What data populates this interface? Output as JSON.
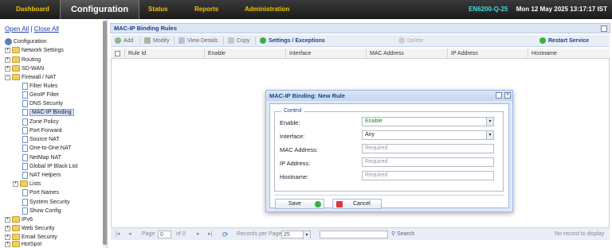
{
  "nav": {
    "items": [
      "Dashboard",
      "Configuration",
      "Status",
      "Reports",
      "Administration"
    ],
    "device": "EN6200-Q-25",
    "datetime": "Mon 12 May 2025 13:17:17 IST"
  },
  "sidebar": {
    "open_all": "Open All",
    "sep": "|",
    "close_all": "Close All",
    "root": "Configuration",
    "items": [
      "Network Settings",
      "Routing",
      "SD-WAN",
      "Firewall / NAT",
      "Filter Rules",
      "GeoIP Filter",
      "DNS Security",
      "MAC-IP Binding",
      "Zone Policy",
      "Port Forward",
      "Source NAT",
      "One-to-One NAT",
      "NetMap NAT",
      "Global IP Black List",
      "NAT Helpers",
      "Lists",
      "Port Names",
      "System Security",
      "Show Config",
      "IPv6",
      "Web Security",
      "Email Security",
      "HotSpot"
    ]
  },
  "panel": {
    "title": "MAC-IP Binding Rules",
    "toolbar": {
      "add": "Add",
      "modify": "Modify",
      "view_details": "View Details",
      "copy": "Copy",
      "settings": "Settings / Exceptions",
      "delete": "Delete",
      "restart": "Restart Service"
    },
    "columns": [
      "Rule Id",
      "Enable",
      "Interface",
      "MAC Address",
      "IP Address",
      "Hostname"
    ],
    "pager": {
      "page": "Page",
      "page_value": "0",
      "of": "of 0",
      "records_per_page": "Records per Page",
      "records_value": "25",
      "search": "Search",
      "empty": "No record to display"
    }
  },
  "dialog": {
    "title": "MAC-IP Binding: New Rule",
    "legend": "Control",
    "fields": {
      "enable": {
        "label": "Enable:",
        "value": "Enable"
      },
      "interface": {
        "label": "Interface:",
        "value": "Any"
      },
      "mac": {
        "label": "MAC Address:",
        "placeholder": "Required"
      },
      "ip": {
        "label": "IP Address:",
        "placeholder": "Required"
      },
      "hostname": {
        "label": "Hostname:",
        "placeholder": "Required"
      }
    },
    "save": "Save",
    "cancel": "Cancel"
  },
  "colors": {
    "nav_accent": "#f5c400",
    "device": "#3de0e0",
    "panel_title": "#15428b",
    "green_icon": "#3fae3f",
    "red_icon": "#d83a3a"
  }
}
